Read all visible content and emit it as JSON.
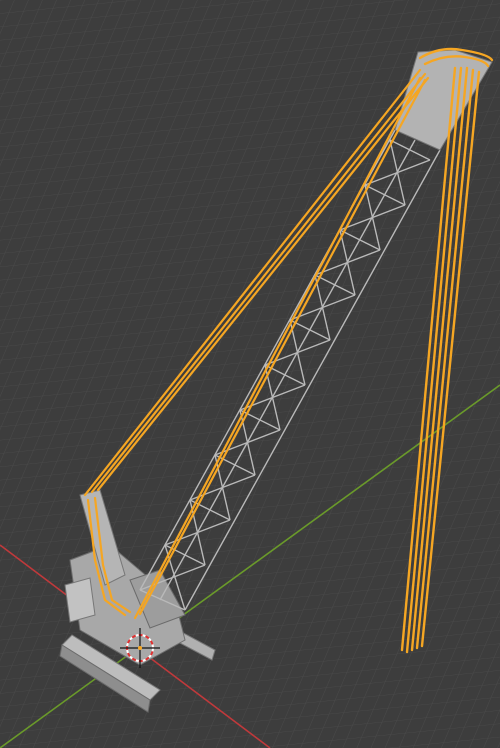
{
  "viewport": {
    "name": "3D Viewport",
    "background_color": "#3d3d3d",
    "grid_color": "#4a4a4a",
    "x_axis_color": "#c0393b",
    "y_axis_color": "#6a9a2a"
  },
  "scene": {
    "object": "crawler-crane",
    "selection_outline_color": "#f5a623",
    "model_color": "#a8a8a8",
    "origin_marker_icon": "3d-cursor-icon"
  }
}
